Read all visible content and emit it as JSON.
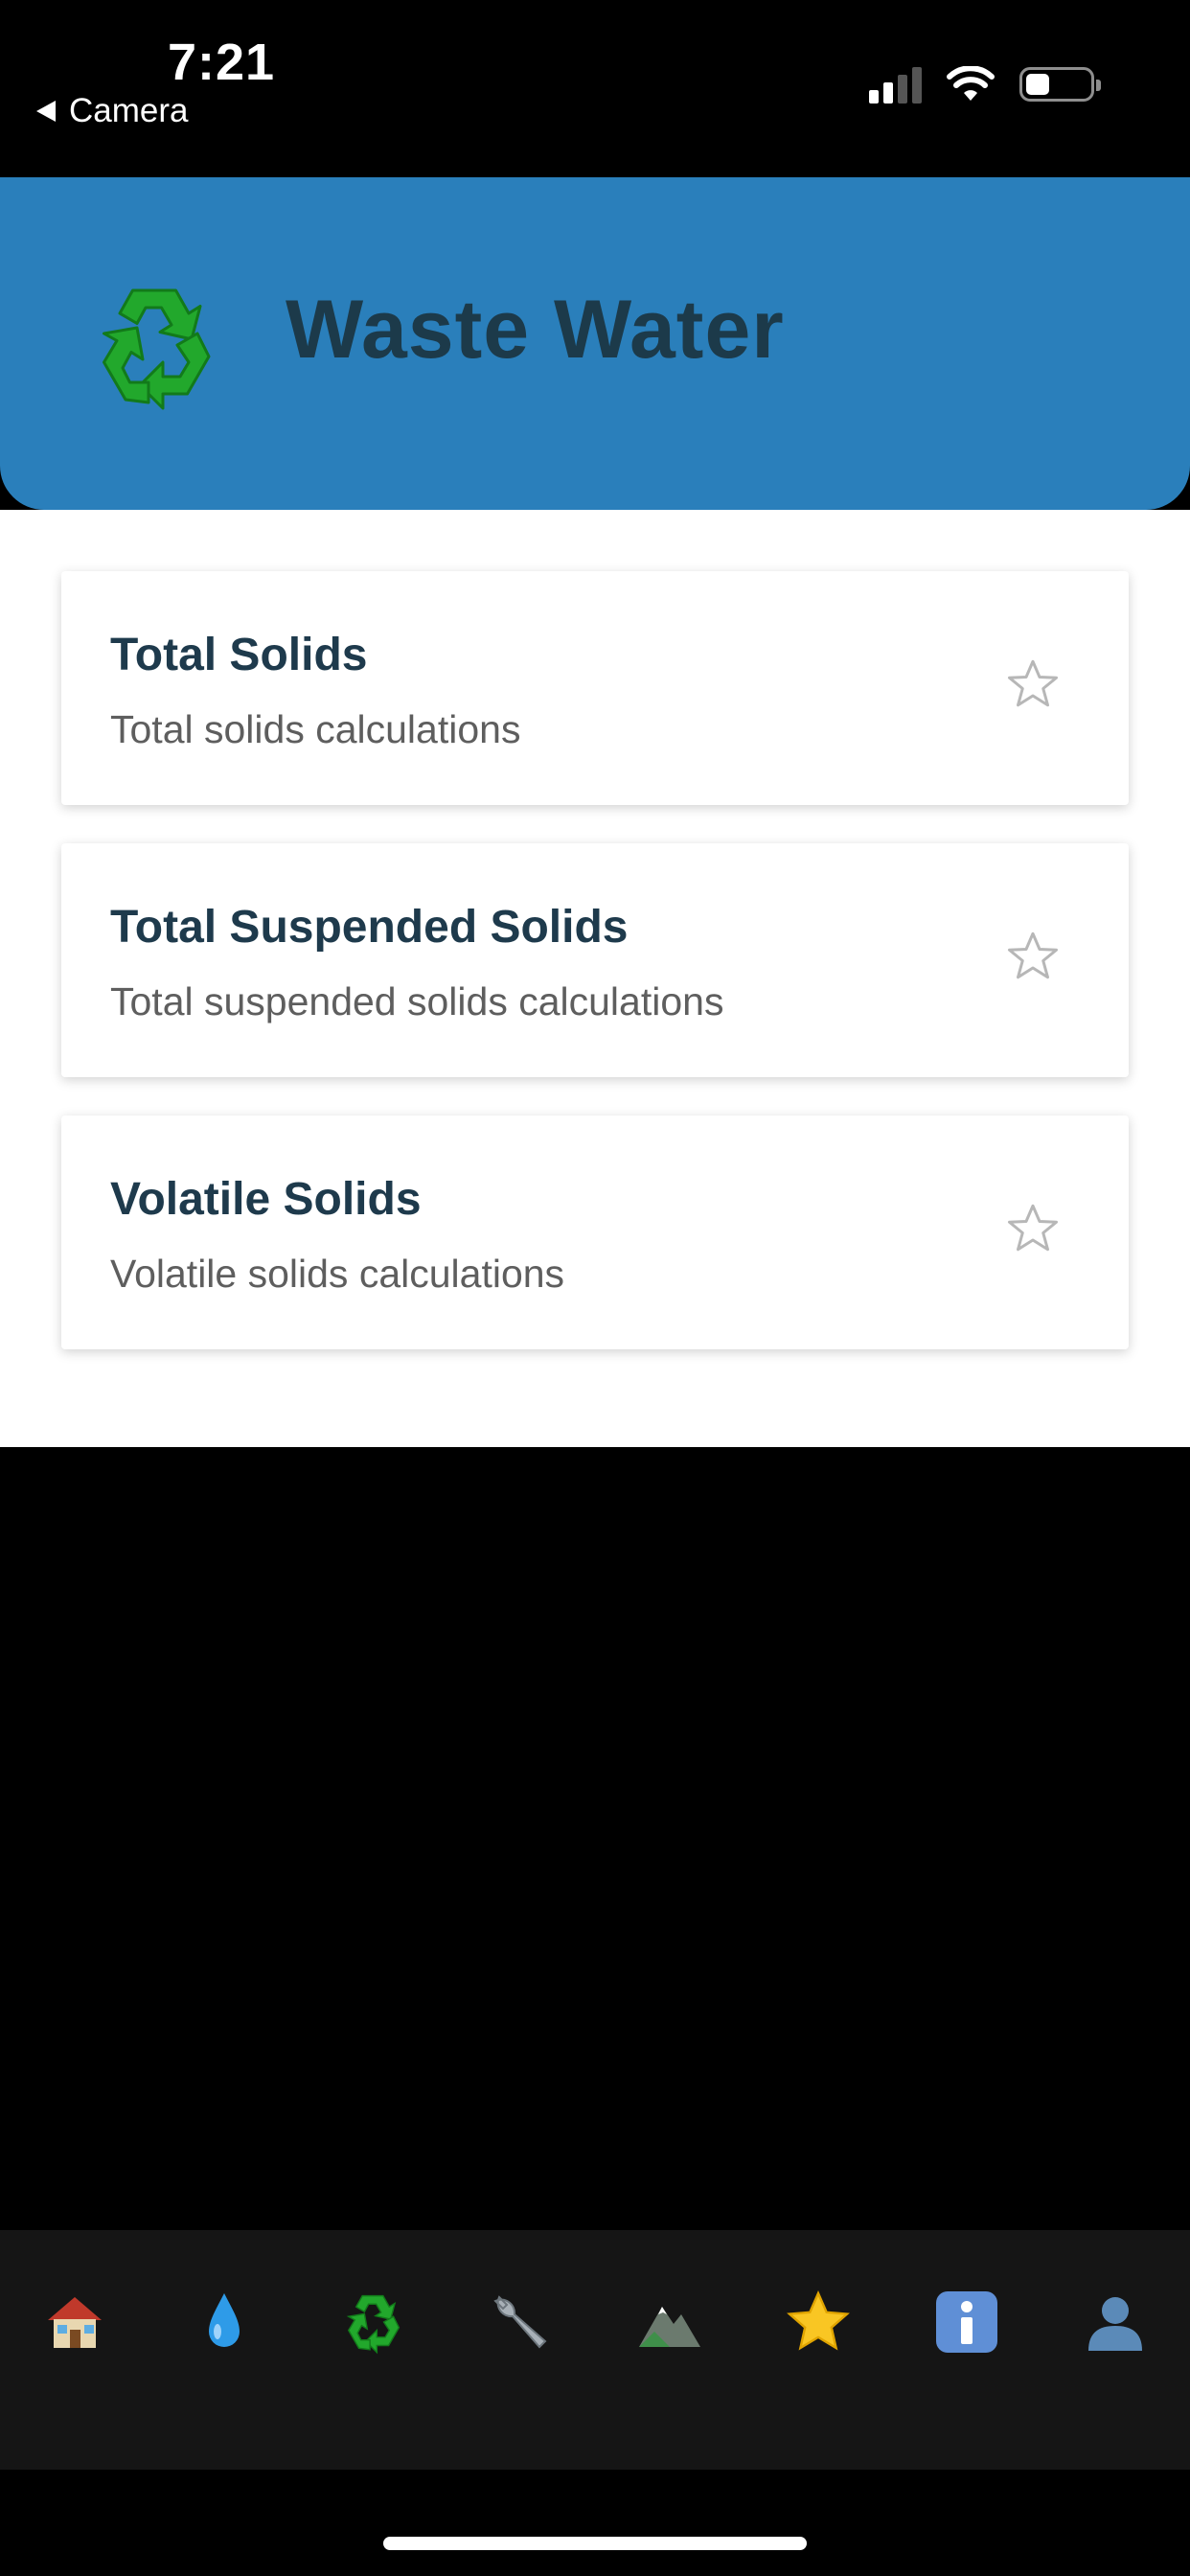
{
  "status_bar": {
    "time": "7:21",
    "back_label": "Camera"
  },
  "header": {
    "title": "Waste Water",
    "icon": "recycle-icon"
  },
  "cards": [
    {
      "title": "Total Solids",
      "subtitle": "Total solids calculations",
      "favorite_icon": "star-outline-icon"
    },
    {
      "title": "Total Suspended Solids",
      "subtitle": "Total suspended solids calculations",
      "favorite_icon": "star-outline-icon"
    },
    {
      "title": "Volatile Solids",
      "subtitle": "Volatile solids calculations",
      "favorite_icon": "star-outline-icon"
    }
  ],
  "tabs": [
    {
      "icon": "house-icon"
    },
    {
      "icon": "water-drop-icon"
    },
    {
      "icon": "recycle-icon"
    },
    {
      "icon": "wrench-icon"
    },
    {
      "icon": "mountain-icon"
    },
    {
      "icon": "star-icon"
    },
    {
      "icon": "info-icon"
    },
    {
      "icon": "user-icon"
    }
  ],
  "colors": {
    "header_bg": "#2a7fbb",
    "title_text": "#1c3a4a",
    "recycle_green": "#1fa62a"
  }
}
